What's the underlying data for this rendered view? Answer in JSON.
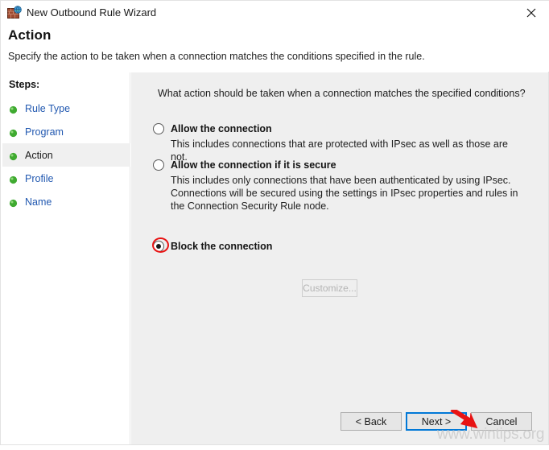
{
  "window": {
    "title": "New Outbound Rule Wizard",
    "icon": "firewall-icon",
    "close_label": "✕"
  },
  "header": {
    "title": "Action",
    "subtitle": "Specify the action to be taken when a connection matches the conditions specified in the rule."
  },
  "sidebar": {
    "heading": "Steps:",
    "items": [
      {
        "label": "Rule Type",
        "current": false
      },
      {
        "label": "Program",
        "current": false
      },
      {
        "label": "Action",
        "current": true
      },
      {
        "label": "Profile",
        "current": false
      },
      {
        "label": "Name",
        "current": false
      }
    ]
  },
  "main": {
    "question": "What action should be taken when a connection matches the specified conditions?",
    "options": [
      {
        "title": "Allow the connection",
        "description": "This includes connections that are protected with IPsec as well as those are not.",
        "selected": false
      },
      {
        "title": "Allow the connection if it is secure",
        "description": "This includes only connections that have been authenticated by using IPsec.  Connections will be secured using the settings in IPsec properties and rules in the Connection Security Rule node.",
        "selected": false
      },
      {
        "title": "Block the connection",
        "description": "",
        "selected": true
      }
    ],
    "customize_label": "Customize..."
  },
  "footer": {
    "back_label": "< Back",
    "next_label": "Next >",
    "cancel_label": "Cancel"
  },
  "annotations": {
    "watermark": "www.wintips.org",
    "highlight_color": "#e81313",
    "accent_color": "#0078d7"
  }
}
